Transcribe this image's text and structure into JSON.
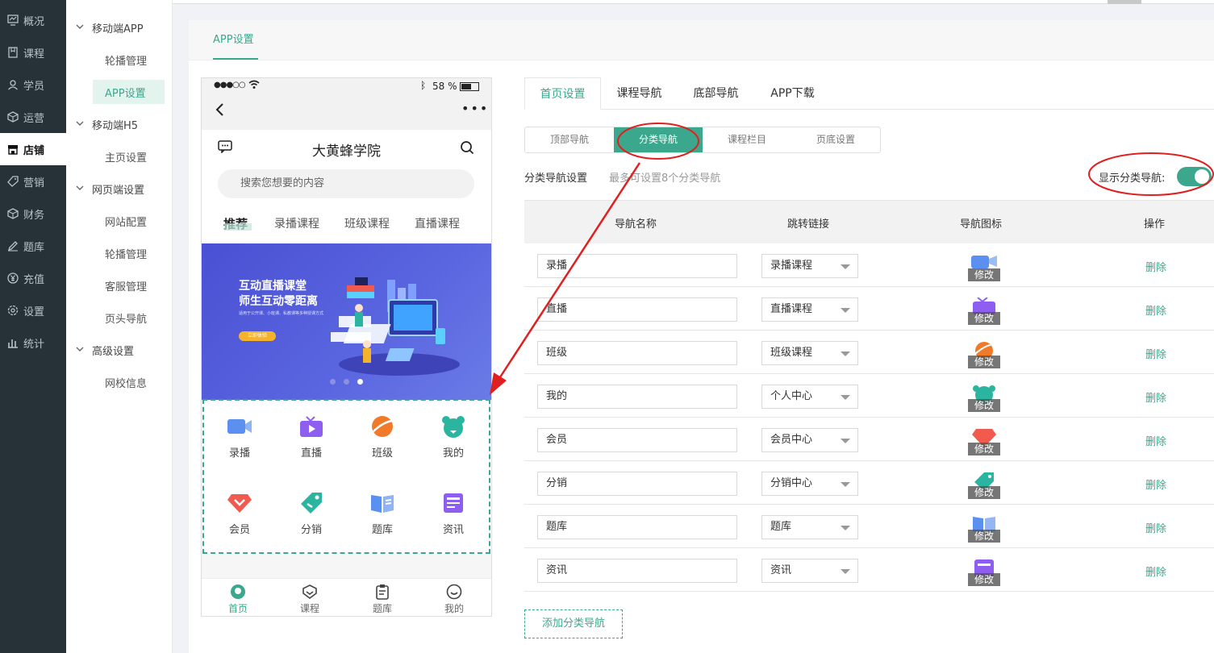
{
  "sidebar": {
    "items": [
      {
        "label": "概况",
        "icon": "dashboard-icon"
      },
      {
        "label": "课程",
        "icon": "book-icon"
      },
      {
        "label": "学员",
        "icon": "user-icon"
      },
      {
        "label": "运营",
        "icon": "cube-icon"
      },
      {
        "label": "店铺",
        "icon": "store-icon",
        "active": true
      },
      {
        "label": "营销",
        "icon": "tag-icon"
      },
      {
        "label": "财务",
        "icon": "cube-icon"
      },
      {
        "label": "题库",
        "icon": "edit-icon"
      },
      {
        "label": "充值",
        "icon": "yen-icon"
      },
      {
        "label": "设置",
        "icon": "gear-icon"
      },
      {
        "label": "统计",
        "icon": "bar-chart-icon"
      }
    ]
  },
  "subnav": {
    "groups": [
      {
        "label": "移动端APP",
        "items": [
          "轮播管理",
          "APP设置"
        ]
      },
      {
        "label": "移动端H5",
        "items": [
          "主页设置"
        ]
      },
      {
        "label": "网页端设置",
        "items": [
          "网站配置",
          "轮播管理",
          "客服管理",
          "页头导航"
        ]
      },
      {
        "label": "高级设置",
        "items": [
          "网校信息"
        ]
      }
    ],
    "active": "APP设置"
  },
  "page_tab": "APP设置",
  "phone": {
    "status_time": "●●●○○",
    "battery": "58 %",
    "title": "大黄蜂学院",
    "search_placeholder": "搜索您想要的内容",
    "tabs": [
      "推荐",
      "录播课程",
      "班级课程",
      "直播课程"
    ],
    "banner": {
      "line1": "互动直播课堂",
      "line2": "师生互动零距离",
      "small": "适用于公开课、小班课、私教课等多种授课方式",
      "button": "立即体验"
    },
    "grid": [
      {
        "label": "录播",
        "icon": "video-camera-icon",
        "color": "#5b8ff0"
      },
      {
        "label": "直播",
        "icon": "tv-play-icon",
        "color": "#8e5ef0"
      },
      {
        "label": "班级",
        "icon": "planet-icon",
        "color": "#f07a2a"
      },
      {
        "label": "我的",
        "icon": "bear-icon",
        "color": "#2bb5a0"
      },
      {
        "label": "会员",
        "icon": "diamond-icon",
        "color": "#f05a4f"
      },
      {
        "label": "分销",
        "icon": "price-tag-icon",
        "color": "#2bb5a0"
      },
      {
        "label": "题库",
        "icon": "open-book-icon",
        "color": "#5b8ff0"
      },
      {
        "label": "资讯",
        "icon": "news-icon",
        "color": "#8e5ef0"
      }
    ],
    "bottom_tabs": [
      {
        "label": "首页",
        "icon": "home-icon",
        "active": true
      },
      {
        "label": "课程",
        "icon": "course-icon"
      },
      {
        "label": "题库",
        "icon": "clipboard-icon"
      },
      {
        "label": "我的",
        "icon": "smile-icon"
      }
    ]
  },
  "top_tabs": [
    "首页设置",
    "课程导航",
    "底部导航",
    "APP下载"
  ],
  "active_top_tab": "首页设置",
  "sub_tabs": [
    "顶部导航",
    "分类导航",
    "课程栏目",
    "页底设置"
  ],
  "active_sub_tab": "分类导航",
  "section": {
    "label": "分类导航设置",
    "hint": "最多可设置8个分类导航",
    "toggle_label": "显示分类导航:",
    "toggle_on": true
  },
  "table": {
    "headers": [
      "导航名称",
      "跳转链接",
      "导航图标",
      "操作"
    ],
    "rows": [
      {
        "name": "录播",
        "link": "录播课程",
        "icon_color": "#5b8ff0",
        "action": "删除"
      },
      {
        "name": "直播",
        "link": "直播课程",
        "icon_color": "#8e5ef0",
        "action": "删除"
      },
      {
        "name": "班级",
        "link": "班级课程",
        "icon_color": "#f07a2a",
        "action": "删除"
      },
      {
        "name": "我的",
        "link": "个人中心",
        "icon_color": "#2bb5a0",
        "action": "删除"
      },
      {
        "name": "会员",
        "link": "会员中心",
        "icon_color": "#f05a4f",
        "action": "删除"
      },
      {
        "name": "分销",
        "link": "分销中心",
        "icon_color": "#2bb5a0",
        "action": "删除"
      },
      {
        "name": "题库",
        "link": "题库",
        "icon_color": "#5b8ff0",
        "action": "删除"
      },
      {
        "name": "资讯",
        "link": "资讯",
        "icon_color": "#8e5ef0",
        "action": "删除"
      }
    ],
    "icon_overlay": "修改"
  },
  "add_button": "添加分类导航",
  "colors": {
    "accent": "#3ba88d",
    "annotation": "#e02020",
    "sidebar": "#263238"
  }
}
